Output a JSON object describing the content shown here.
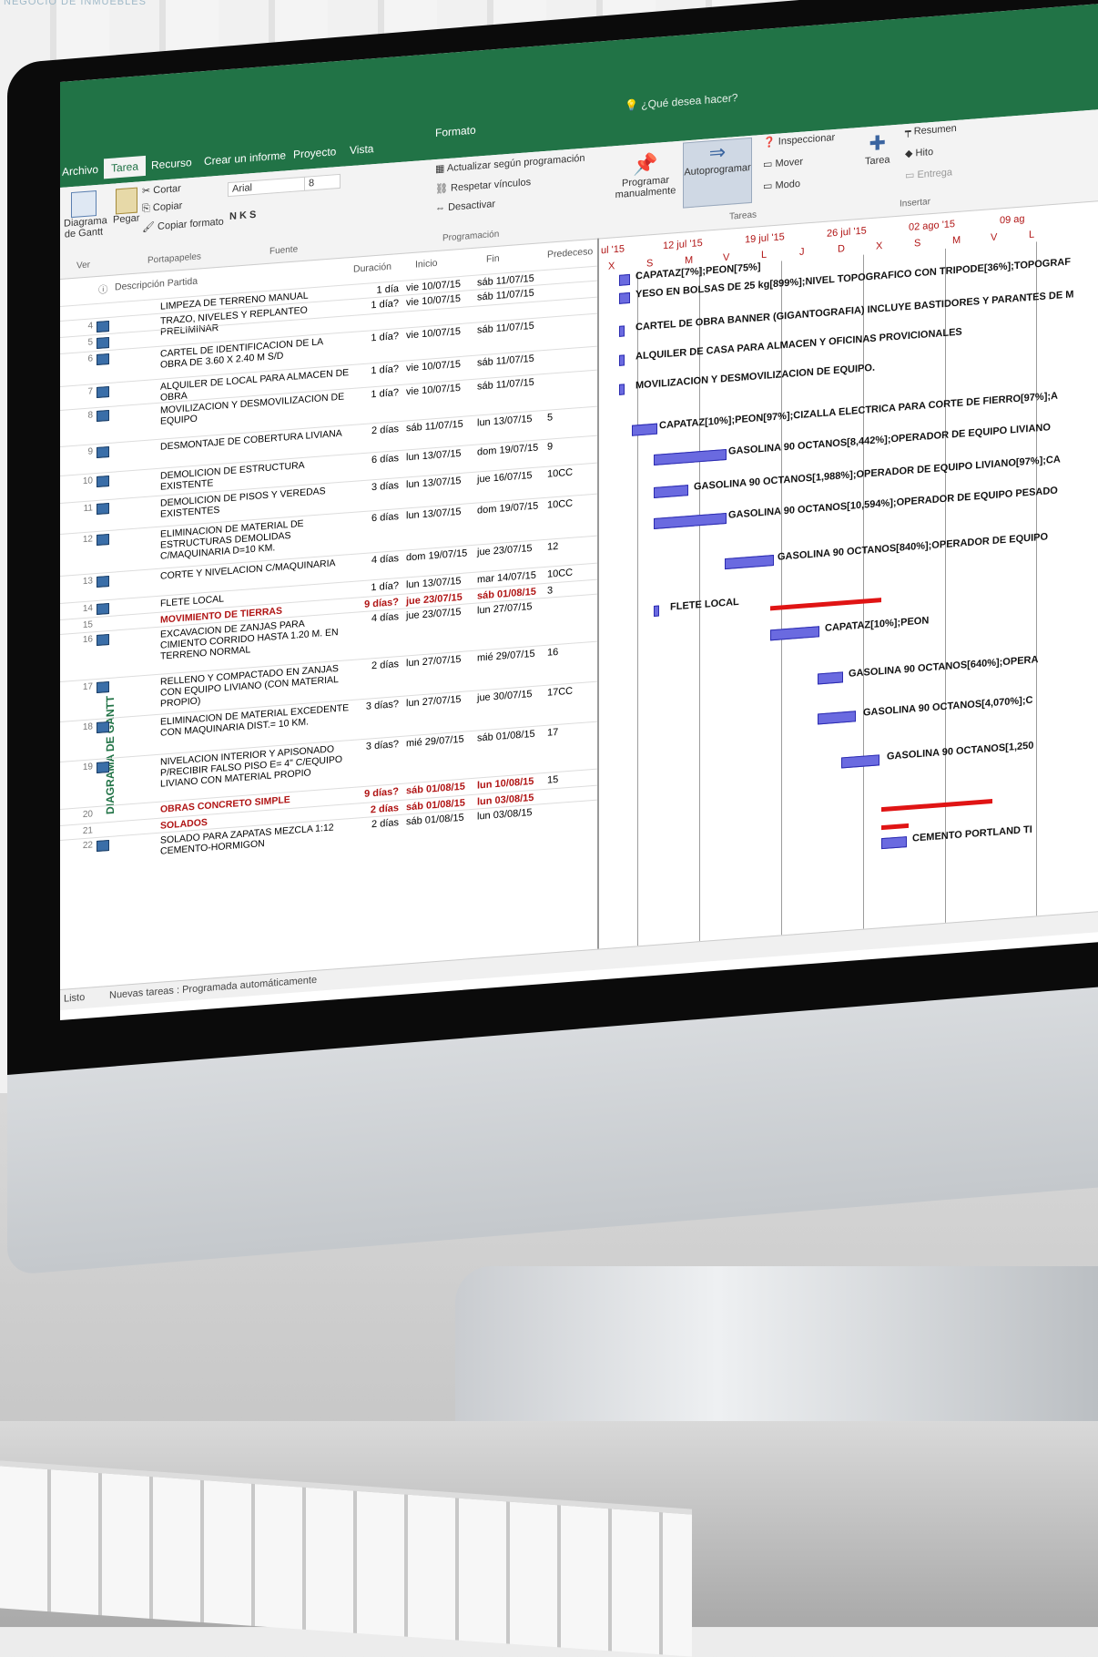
{
  "header_caption": "NEGOCIO DE INMUEBLES",
  "ribbon": {
    "tabs": [
      "Archivo",
      "Tarea",
      "Recurso",
      "Crear un informe",
      "Proyecto",
      "Vista"
    ],
    "format_tab": "Formato",
    "search": "¿Qué desea hacer?",
    "diagram_btn": "Diagrama de Gantt",
    "ver_group": "Ver",
    "paste": "Pegar",
    "cut": "Cortar",
    "copy": "Copiar",
    "copy_format": "Copiar formato",
    "clipboard_group": "Portapapeles",
    "font_name": "Arial",
    "font_size": "8",
    "font_group": "Fuente",
    "update_schedule": "Actualizar según programación",
    "respect_links": "Respetar vínculos",
    "deactivate": "Desactivar",
    "schedule_group": "Programación",
    "manual": "Programar manualmente",
    "auto": "Autoprogramar",
    "inspect": "Inspeccionar",
    "move": "Mover",
    "mode": "Modo",
    "tasks_group": "Tareas",
    "task_btn": "Tarea",
    "summary": "Resumen",
    "milestone": "Hito",
    "deliverable": "Entrega",
    "insert_group": "Insertar"
  },
  "table": {
    "headers": {
      "name": "Descripción Partida",
      "dur": "Duración",
      "start": "Inicio",
      "end": "Fin",
      "pred": "Predeceso"
    },
    "side_label": "DIAGRAMA DE GANTT",
    "rows": [
      {
        "n": "",
        "name": "LIMPEZA DE TERRENO MANUAL",
        "dur": "1 día",
        "start": "vie 10/07/15",
        "end": "sáb 11/07/15",
        "pred": ""
      },
      {
        "n": "4",
        "name": "TRAZO, NIVELES Y REPLANTEO PRELIMINAR",
        "dur": "1 día?",
        "start": "vie 10/07/15",
        "end": "sáb 11/07/15",
        "pred": ""
      },
      {
        "n": "5",
        "name": "",
        "dur": "",
        "start": "",
        "end": "",
        "pred": ""
      },
      {
        "n": "6",
        "name": "CARTEL DE IDENTIFICACION DE LA OBRA DE 3.60 X 2.40 M S/D",
        "dur": "1 día?",
        "start": "vie 10/07/15",
        "end": "sáb 11/07/15",
        "pred": ""
      },
      {
        "n": "7",
        "name": "ALQUILER DE LOCAL PARA ALMACEN DE OBRA",
        "dur": "1 día?",
        "start": "vie 10/07/15",
        "end": "sáb 11/07/15",
        "pred": ""
      },
      {
        "n": "8",
        "name": "MOVILIZACION Y DESMOVILIZACION DE EQUIPO",
        "dur": "1 día?",
        "start": "vie 10/07/15",
        "end": "sáb 11/07/15",
        "pred": ""
      },
      {
        "n": "9",
        "name": "DESMONTAJE DE COBERTURA LIVIANA",
        "dur": "2 días",
        "start": "sáb 11/07/15",
        "end": "lun 13/07/15",
        "pred": "5"
      },
      {
        "n": "10",
        "name": "DEMOLICION DE ESTRUCTURA EXISTENTE",
        "dur": "6 días",
        "start": "lun 13/07/15",
        "end": "dom 19/07/15",
        "pred": "9"
      },
      {
        "n": "11",
        "name": "DEMOLICION DE PISOS Y VEREDAS EXISTENTES",
        "dur": "3 días",
        "start": "lun 13/07/15",
        "end": "jue 16/07/15",
        "pred": "10CC"
      },
      {
        "n": "12",
        "name": "ELIMINACION DE MATERIAL DE ESTRUCTURAS DEMOLIDAS C/MAQUINARIA D=10 KM.",
        "dur": "6 días",
        "start": "lun 13/07/15",
        "end": "dom 19/07/15",
        "pred": "10CC"
      },
      {
        "n": "13",
        "name": "CORTE Y NIVELACION C/MAQUINARIA",
        "dur": "4 días",
        "start": "dom 19/07/15",
        "end": "jue 23/07/15",
        "pred": "12"
      },
      {
        "n": "14",
        "name": "FLETE LOCAL",
        "dur": "1 día?",
        "start": "lun 13/07/15",
        "end": "mar 14/07/15",
        "pred": "10CC"
      },
      {
        "n": "15",
        "name": "MOVIMIENTO DE TIERRAS",
        "dur": "9 días?",
        "start": "jue 23/07/15",
        "end": "sáb 01/08/15",
        "pred": "3",
        "summary": true
      },
      {
        "n": "16",
        "name": "EXCAVACION DE ZANJAS PARA CIMIENTO CORRIDO HASTA 1.20 M. EN TERRENO NORMAL",
        "dur": "4 días",
        "start": "jue 23/07/15",
        "end": "lun 27/07/15",
        "pred": ""
      },
      {
        "n": "17",
        "name": "RELLENO Y COMPACTADO EN ZANJAS CON EQUIPO LIVIANO (CON MATERIAL PROPIO)",
        "dur": "2 días",
        "start": "lun 27/07/15",
        "end": "mié 29/07/15",
        "pred": "16"
      },
      {
        "n": "18",
        "name": "ELIMINACION DE MATERIAL EXCEDENTE CON MAQUINARIA DIST.= 10 KM.",
        "dur": "3 días?",
        "start": "lun 27/07/15",
        "end": "jue 30/07/15",
        "pred": "17CC"
      },
      {
        "n": "19",
        "name": "NIVELACION INTERIOR Y APISONADO P/RECIBIR FALSO PISO E= 4\" C/EQUIPO LIVIANO CON MATERIAL PROPIO",
        "dur": "3 días?",
        "start": "mié 29/07/15",
        "end": "sáb 01/08/15",
        "pred": "17"
      },
      {
        "n": "20",
        "name": "OBRAS CONCRETO SIMPLE",
        "dur": "9 días?",
        "start": "sáb 01/08/15",
        "end": "lun 10/08/15",
        "pred": "15",
        "summary": true
      },
      {
        "n": "21",
        "name": "SOLADOS",
        "dur": "2 días",
        "start": "sáb 01/08/15",
        "end": "lun 03/08/15",
        "pred": "",
        "summary": true
      },
      {
        "n": "22",
        "name": "SOLADO PARA ZAPATAS MEZCLA 1:12 CEMENTO-HORMIGON",
        "dur": "2 días",
        "start": "sáb 01/08/15",
        "end": "lun 03/08/15",
        "pred": ""
      }
    ]
  },
  "gantt": {
    "dates": [
      "ul '15",
      "12 jul '15",
      "19 jul '15",
      "26 jul '15",
      "02 ago '15",
      "09 ag"
    ],
    "days": [
      "X",
      "S",
      "M",
      "V",
      "L",
      "J",
      "D",
      "X",
      "S",
      "M",
      "V",
      "L"
    ],
    "labels": [
      "CAPATAZ[7%];PEON[75%]",
      "YESO EN BOLSAS DE 25 kg[899%];NIVEL TOPOGRAFICO CON TRIPODE[36%];TOPOGRAF",
      "CARTEL DE OBRA BANNER (GIGANTOGRAFIA) INCLUYE BASTIDORES Y PARANTES DE M",
      "ALQUILER DE CASA PARA ALMACEN Y OFICINAS PROVICIONALES",
      "MOVILIZACION Y DESMOVILIZACION DE EQUIPO.",
      "CAPATAZ[10%];PEON[97%];CIZALLA ELECTRICA PARA CORTE DE FIERRO[97%];A",
      "GASOLINA 90 OCTANOS[8,442%];OPERADOR DE EQUIPO LIVIANO",
      "GASOLINA 90 OCTANOS[1,988%];OPERADOR DE EQUIPO LIVIANO[97%];CA",
      "GASOLINA 90 OCTANOS[10,594%];OPERADOR DE EQUIPO PESADO",
      "GASOLINA 90 OCTANOS[840%];OPERADOR DE EQUIPO",
      "FLETE LOCAL",
      "CAPATAZ[10%];PEON",
      "GASOLINA 90 OCTANOS[640%];OPERA",
      "GASOLINA 90 OCTANOS[4,070%];C",
      "GASOLINA 90 OCTANOS[1,250",
      "CEMENTO PORTLAND TI"
    ]
  },
  "status": {
    "ready": "Listo",
    "new_tasks": "Nuevas tareas : Programada automáticamente"
  }
}
